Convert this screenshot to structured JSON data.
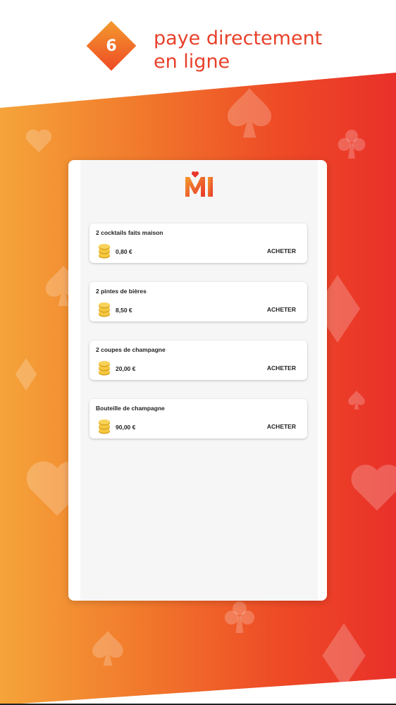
{
  "step": {
    "number": "6",
    "headline_line1": "paye directement",
    "headline_line2": "en ligne",
    "badge_color": "#ee4a25"
  },
  "background": {
    "gradient_start": "#f5a43a",
    "gradient_end": "#e9302a",
    "suit_icons": [
      "heart-icon",
      "spade-icon",
      "club-icon",
      "diamond-icon"
    ]
  },
  "app": {
    "logo_icon": "mi-logo-icon",
    "currency_icon": "coin-stack-icon",
    "offers": [
      {
        "title": "2 cocktails faits maison",
        "price": "0,80 €",
        "action": "ACHETER"
      },
      {
        "title": "2 pintes de bières",
        "price": "8,50 €",
        "action": "ACHETER"
      },
      {
        "title": "2 coupes de champagne",
        "price": "20,00 €",
        "action": "ACHETER"
      },
      {
        "title": "Bouteille de champagne",
        "price": "90,00 €",
        "action": "ACHETER"
      }
    ]
  }
}
